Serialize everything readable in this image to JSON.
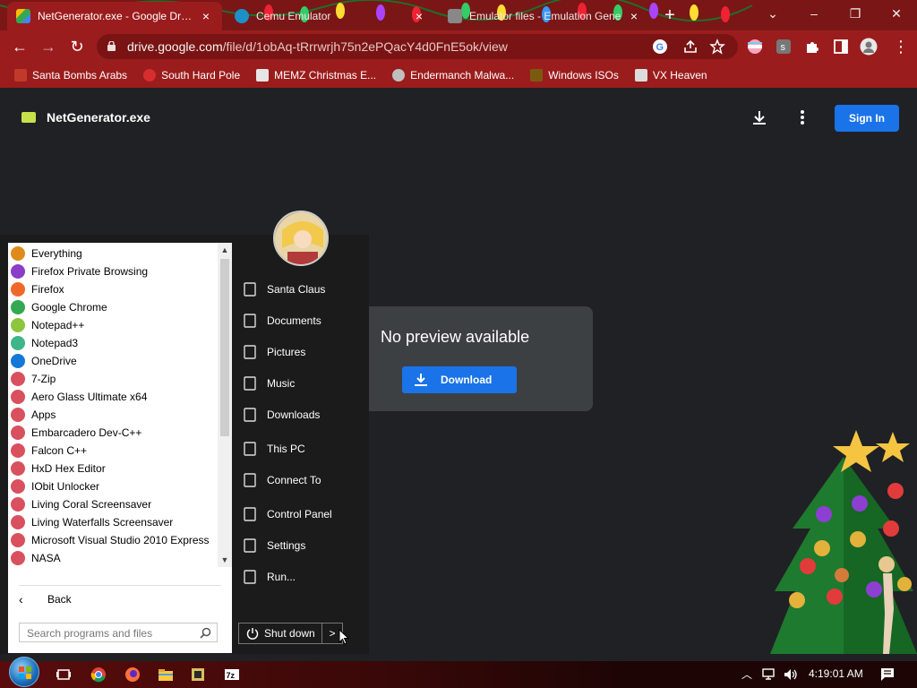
{
  "browser": {
    "tabs": [
      {
        "title": "NetGenerator.exe - Google Drive",
        "active": true,
        "close": "×"
      },
      {
        "title": "Cemu Emulator",
        "active": false,
        "close": "×"
      },
      {
        "title": "Emulator files - Emulation Gene",
        "active": false,
        "close": "×"
      }
    ],
    "new_tab": "+",
    "window_controls": {
      "minimize": "–",
      "restore": "❐",
      "close": "✕",
      "tabsearch": "⌄"
    },
    "url_host": "drive.google.com",
    "url_path": "/file/d/1obAq-tRrrwrjh75n2ePQacY4d0FnE5ok/view",
    "bookmarks": [
      {
        "label": "Santa Bombs Arabs",
        "color": "#c0392b"
      },
      {
        "label": "South Hard Pole",
        "color": "#d62d2d"
      },
      {
        "label": "MEMZ Christmas E...",
        "color": "#e6e6e6"
      },
      {
        "label": "Endermanch Malwa...",
        "color": "#bfbfbf"
      },
      {
        "label": "Windows ISOs",
        "color": "#7a5a10"
      },
      {
        "label": "VX Heaven",
        "color": "#dcdcdc"
      }
    ]
  },
  "drive": {
    "filename": "NetGenerator.exe",
    "signin_label": "Sign In",
    "preview_message": "No preview available",
    "download_label": "Download"
  },
  "startmenu": {
    "programs": [
      {
        "label": "Everything",
        "color": "#e08a1e"
      },
      {
        "label": "Firefox Private Browsing",
        "color": "#8a3ec8"
      },
      {
        "label": "Firefox",
        "color": "#f0692a"
      },
      {
        "label": "Google Chrome",
        "color": "#34a853"
      },
      {
        "label": "Notepad++",
        "color": "#8cc63e"
      },
      {
        "label": "Notepad3",
        "color": "#3fb58a"
      },
      {
        "label": "OneDrive",
        "color": "#1577d6"
      },
      {
        "label": "7-Zip",
        "color": "#d9505e"
      },
      {
        "label": "Aero Glass Ultimate x64",
        "color": "#d9505e"
      },
      {
        "label": "Apps",
        "color": "#d9505e"
      },
      {
        "label": "Embarcadero Dev-C++",
        "color": "#d9505e"
      },
      {
        "label": "Falcon C++",
        "color": "#d9505e"
      },
      {
        "label": "HxD Hex Editor",
        "color": "#d9505e"
      },
      {
        "label": "IObit Unlocker",
        "color": "#d9505e"
      },
      {
        "label": "Living Coral Screensaver",
        "color": "#d9505e"
      },
      {
        "label": "Living Waterfalls Screensaver",
        "color": "#d9505e"
      },
      {
        "label": "Microsoft Visual Studio 2010 Express",
        "color": "#d9505e"
      },
      {
        "label": "NASA",
        "color": "#d9505e"
      }
    ],
    "back_label": "Back",
    "search_placeholder": "Search programs and files",
    "right_items": [
      {
        "label": "Santa Claus",
        "icon": "user-folder-icon"
      },
      {
        "label": "Documents",
        "icon": "document-icon"
      },
      {
        "label": "Pictures",
        "icon": "picture-icon"
      },
      {
        "label": "Music",
        "icon": "music-note-icon"
      },
      {
        "label": "Downloads",
        "icon": "download-arrow-icon"
      },
      {
        "label": "This PC",
        "icon": "computer-icon"
      },
      {
        "label": "Connect To",
        "icon": "network-icon"
      },
      {
        "label": "Control Panel",
        "icon": "wrench-icon"
      },
      {
        "label": "Settings",
        "icon": "gear-icon"
      },
      {
        "label": "Run...",
        "icon": "run-icon"
      }
    ],
    "shutdown_label": "Shut down",
    "shutdown_arrow": ">"
  },
  "taskbar": {
    "clock": "4:19:01 AM"
  }
}
